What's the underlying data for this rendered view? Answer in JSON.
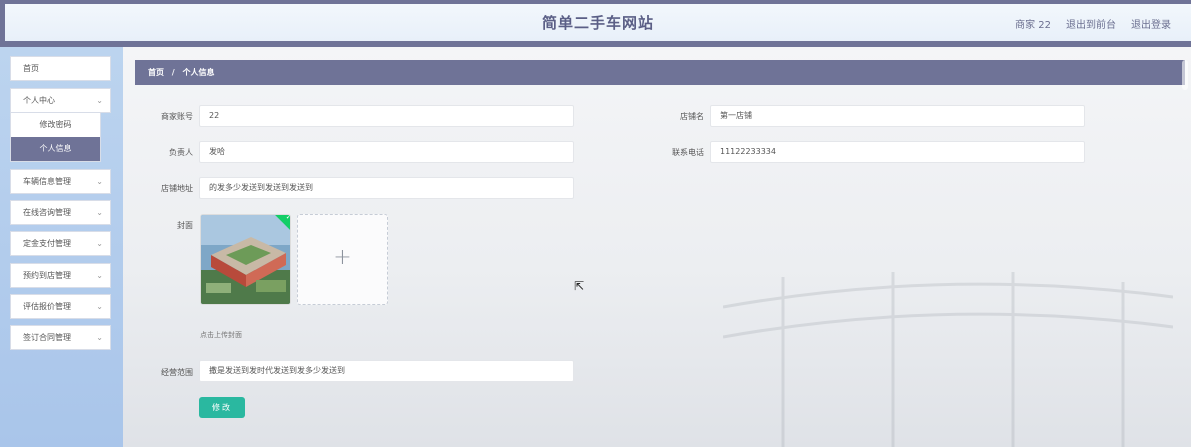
{
  "header": {
    "title": "简单二手车网站",
    "user_label": "商家 22",
    "front_link": "退出到前台",
    "logout_link": "退出登录"
  },
  "sidebar": {
    "items": [
      {
        "label": "首页"
      },
      {
        "label": "个人中心"
      },
      {
        "label": "车辆信息管理"
      },
      {
        "label": "在线咨询管理"
      },
      {
        "label": "定金支付管理"
      },
      {
        "label": "预约到店管理"
      },
      {
        "label": "评估报价管理"
      },
      {
        "label": "签订合同管理"
      }
    ],
    "submenu": [
      {
        "label": "修改密码"
      },
      {
        "label": "个人信息"
      }
    ]
  },
  "breadcrumb": {
    "home": "首页",
    "separator": "/",
    "current": "个人信息"
  },
  "form": {
    "account_label": "商家账号",
    "account_value": "22",
    "shop_name_label": "店铺名",
    "shop_name_value": "第一店铺",
    "manager_label": "负责人",
    "manager_value": "发哈",
    "phone_label": "联系电话",
    "phone_value": "11122233334",
    "address_label": "店铺地址",
    "address_value": "的发多少发送到发送到发送到",
    "cover_label": "封面",
    "upload_plus": "+",
    "upload_hint": "点击上传封面",
    "scope_label": "经营范围",
    "scope_value": "撒是发送到发时代发送到发多少发送到",
    "submit_label": "修改",
    "check_mark": "✓"
  },
  "colors": {
    "accent": "#6f7397",
    "button": "#2ab8a0",
    "sidebar_bg": "#b4cdee"
  }
}
